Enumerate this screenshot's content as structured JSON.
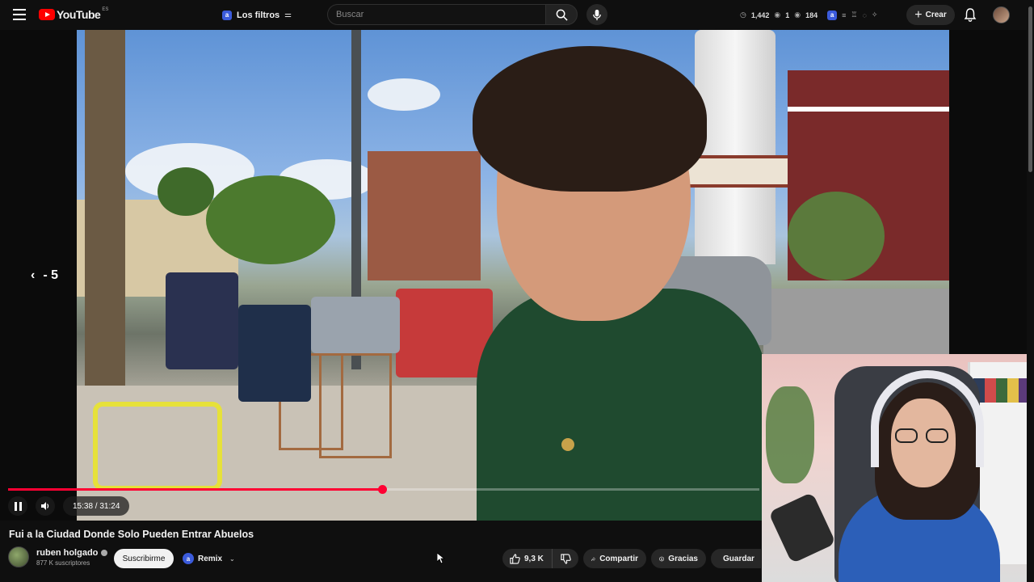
{
  "header": {
    "logo_text": "YouTube",
    "logo_region": "ES",
    "filters_badge": "a",
    "filters_label": "Los filtros",
    "search_placeholder": "Buscar",
    "stats": {
      "views": "1,442",
      "a": "1",
      "b": "184"
    },
    "create_label": "Crear"
  },
  "player": {
    "seek_back_label": "- 5",
    "time": "15:38 / 31:24",
    "progress": 0.498
  },
  "video": {
    "title": "Fui a la Ciudad Donde Solo Pueden Entrar Abuelos",
    "channel_name": "ruben holgado",
    "channel_subs": "877 K suscriptores",
    "subscribe_label": "Suscribirme",
    "remix_label": "Remix",
    "remix_badge": "a",
    "likes": "9,3 K",
    "share_label": "Compartir",
    "thanks_label": "Gracias",
    "save_label": "Guardar"
  },
  "colors": {
    "accent_red": "#ff0033",
    "background": "#0f0f0f",
    "pill_bg": "#272727"
  }
}
